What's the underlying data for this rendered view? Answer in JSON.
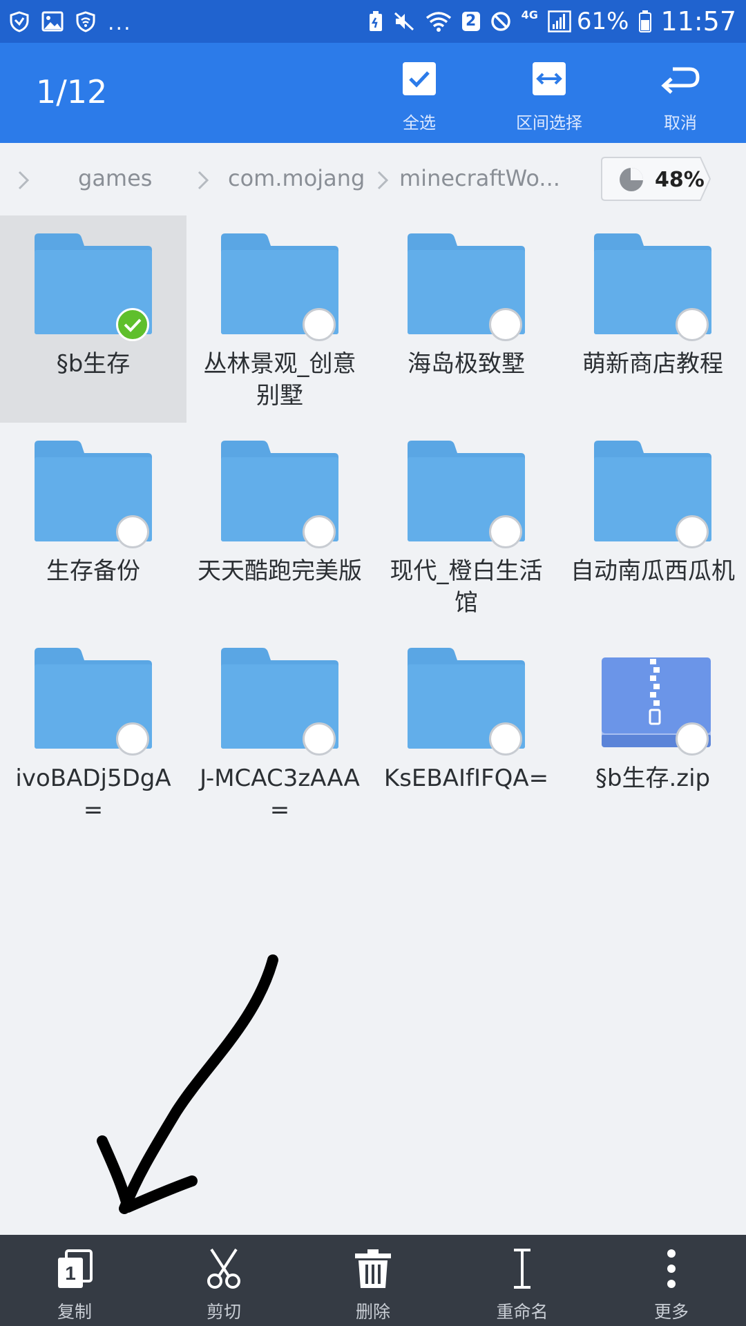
{
  "status_bar": {
    "more_indicator": "...",
    "sim_badge": "2",
    "network_type": "4G",
    "battery_percent": "61%",
    "clock": "11:57"
  },
  "app_bar": {
    "selection_count": "1/12",
    "actions": {
      "select_all": "全选",
      "range_select": "区间选择",
      "cancel": "取消"
    }
  },
  "breadcrumb": {
    "items": [
      "games",
      "com.mojang",
      "minecraftWo..."
    ],
    "storage_percent": "48%"
  },
  "files": [
    {
      "name": "§b生存",
      "type": "folder",
      "selected": true
    },
    {
      "name": "丛林景观_创意别墅",
      "type": "folder",
      "selected": false
    },
    {
      "name": "海岛极致墅",
      "type": "folder",
      "selected": false
    },
    {
      "name": "萌新商店教程",
      "type": "folder",
      "selected": false
    },
    {
      "name": "生存备份",
      "type": "folder",
      "selected": false
    },
    {
      "name": "天天酷跑完美版",
      "type": "folder",
      "selected": false
    },
    {
      "name": "现代_橙白生活馆",
      "type": "folder",
      "selected": false
    },
    {
      "name": "自动南瓜西瓜机",
      "type": "folder",
      "selected": false
    },
    {
      "name": "ivoBADj5DgA=",
      "type": "folder",
      "selected": false
    },
    {
      "name": "J-MCAC3zAAA=",
      "type": "folder",
      "selected": false
    },
    {
      "name": "KsEBAIfIFQA=",
      "type": "folder",
      "selected": false
    },
    {
      "name": "§b生存.zip",
      "type": "zip",
      "selected": false
    }
  ],
  "bottom_toolbar": {
    "copy": "复制",
    "copy_badge": "1",
    "cut": "剪切",
    "delete": "删除",
    "rename": "重命名",
    "more": "更多"
  },
  "colors": {
    "status_bar": "#2063cf",
    "app_bar": "#2c7be9",
    "background": "#f0f2f5",
    "folder": "#62aeea",
    "folder_tab": "#5aa6e4",
    "zip_icon": "#6b95e8",
    "selected_check": "#5fbf2c",
    "selected_item_bg": "#dddfe2",
    "bottom_bar": "#353b44"
  }
}
